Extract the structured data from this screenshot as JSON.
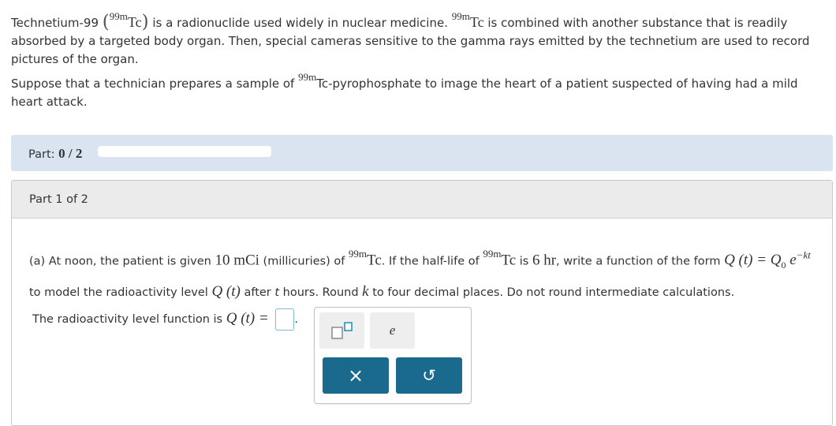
{
  "intro": {
    "p1_a": "Technetium-99",
    "iso": "99m",
    "tc": "Tc",
    "p1_b": "is a radionuclide used widely in nuclear medicine.",
    "p1_c": "is combined with another substance that is readily absorbed by a targeted body organ. Then, special cameras sensitive to the gamma rays emitted by the technetium are used to record pictures of the organ.",
    "p2_a": "Suppose that a technician prepares a sample of",
    "p2_b": "Tc-pyrophosphate to image the heart of a patient suspected of having had a mild heart attack."
  },
  "part_bar": {
    "label": "Part:",
    "value": "0 / 2",
    "progress_fraction": 0
  },
  "part_header": "Part 1 of 2",
  "question": {
    "a1": "(a) At noon, the patient is given",
    "dose": "10 mCi",
    "a2": "(millicuries) of",
    "a3": ". If the half-life of",
    "a4": "is",
    "halflife": "6 hr",
    "a5": ", write a function of the form",
    "formula_lhs": "Q (t) = Q",
    "formula_sub": "0",
    "formula_e": "e",
    "formula_exp": "−kt",
    "b1": "to model the radioactivity level",
    "qt": "Q (t)",
    "b2": "after",
    "t": "t",
    "b3": "hours. Round",
    "k": "k",
    "b4": "to four decimal places. Do not round intermediate calculations."
  },
  "answer": {
    "label": "The radioactivity level function is",
    "expr": "Q (t) ="
  },
  "palette": {
    "superscript_icon": "superscript-template-icon",
    "e_label": "e",
    "clear_symbol": "×",
    "undo_symbol": "↺"
  },
  "colors": {
    "accent": "#1a6a8e",
    "part_bar_bg": "#d9e4f0",
    "answer_box_border": "#7fb8d8"
  }
}
